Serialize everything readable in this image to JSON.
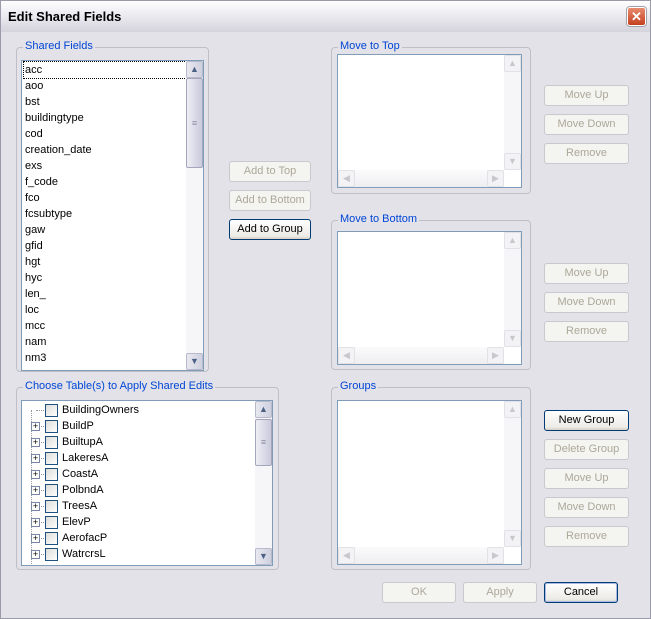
{
  "window": {
    "title": "Edit Shared Fields",
    "close_icon": "close-icon"
  },
  "shared_fields": {
    "legend": "Shared Fields",
    "items": [
      "acc",
      "aoo",
      "bst",
      "buildingtype",
      "cod",
      "creation_date",
      "exs",
      "f_code",
      "fco",
      "fcsubtype",
      "gaw",
      "gfid",
      "hgt",
      "hyc",
      "len_",
      "loc",
      "mcc",
      "nam",
      "nm3"
    ],
    "selected": "acc"
  },
  "add_buttons": {
    "add_to_top": "Add to Top",
    "add_to_bottom": "Add to Bottom",
    "add_to_group": "Add to Group"
  },
  "move_to_top": {
    "legend": "Move to Top",
    "move_up": "Move Up",
    "move_down": "Move Down",
    "remove": "Remove"
  },
  "move_to_bottom": {
    "legend": "Move to Bottom",
    "move_up": "Move Up",
    "move_down": "Move Down",
    "remove": "Remove"
  },
  "groups": {
    "legend": "Groups",
    "new_group": "New Group",
    "delete_group": "Delete Group",
    "move_up": "Move Up",
    "move_down": "Move Down",
    "remove": "Remove"
  },
  "tables": {
    "legend": "Choose Table(s) to Apply Shared Edits",
    "items": [
      {
        "label": "BuildingOwners",
        "expandable": false,
        "checked": false
      },
      {
        "label": "BuildP",
        "expandable": true,
        "checked": false
      },
      {
        "label": "BuiltupA",
        "expandable": true,
        "checked": false
      },
      {
        "label": "LakeresA",
        "expandable": true,
        "checked": false
      },
      {
        "label": "CoastA",
        "expandable": true,
        "checked": false
      },
      {
        "label": "PolbndA",
        "expandable": true,
        "checked": false
      },
      {
        "label": "TreesA",
        "expandable": true,
        "checked": false
      },
      {
        "label": "ElevP",
        "expandable": true,
        "checked": false
      },
      {
        "label": "AerofacP",
        "expandable": true,
        "checked": false
      },
      {
        "label": "WatrcrsL",
        "expandable": true,
        "checked": false
      }
    ]
  },
  "footer": {
    "ok": "OK",
    "apply": "Apply",
    "cancel": "Cancel"
  },
  "colors": {
    "legend": "#0046d5",
    "close": "#c4401f"
  }
}
